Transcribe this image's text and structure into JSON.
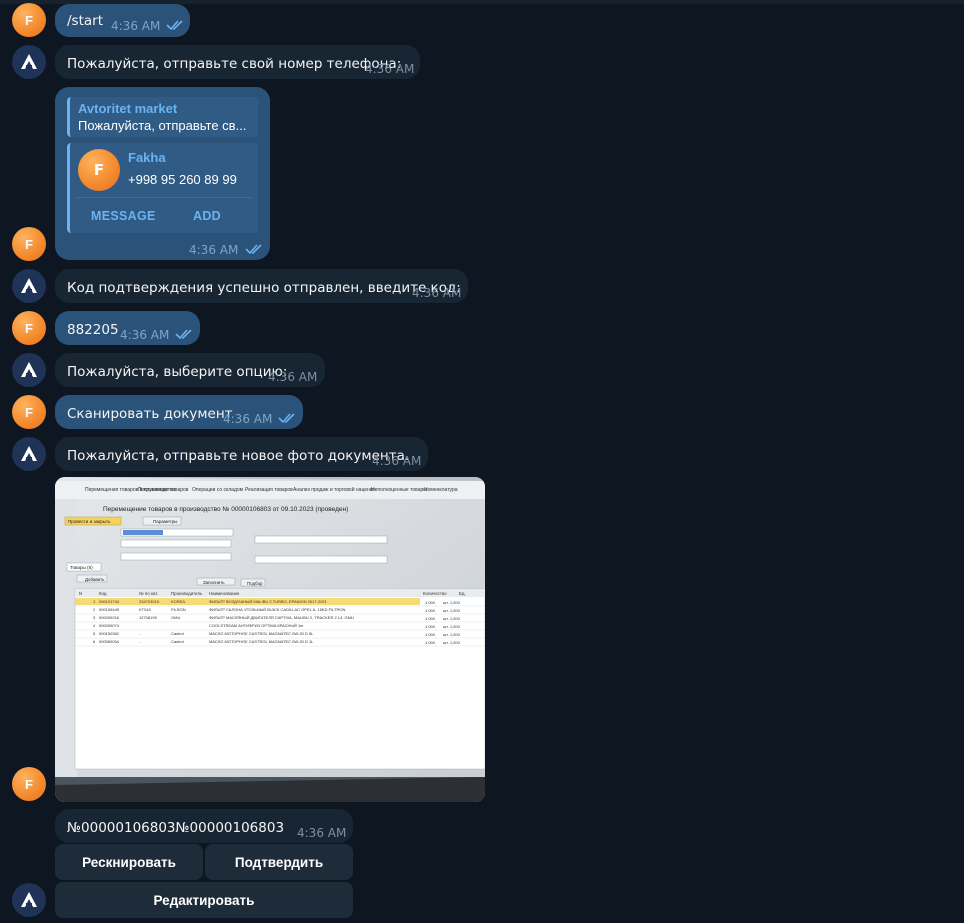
{
  "colors": {
    "background": "#0e1621",
    "outgoing": "#2b5278",
    "incoming": "#182533",
    "accent": "#6ab3f3"
  },
  "user_avatar_letter": "F",
  "messages": {
    "m1": {
      "text": "/start",
      "time": "4:36 AM"
    },
    "m2": {
      "text": "Пожалуйста, отправьте свой номер телефона:",
      "time": "4:36 AM"
    },
    "m3": {
      "reply_author": "Avtoritet market",
      "reply_text": "Пожалуйста, отправьте св...",
      "contact_letter": "F",
      "contact_name": "Fakha",
      "contact_phone": "+998 95 260 89 99",
      "message_label": "MESSAGE",
      "add_label": "ADD",
      "time": "4:36 AM"
    },
    "m4": {
      "text": "Код подтверждения успешно отправлен, введите код:",
      "time": "4:36 AM"
    },
    "m5": {
      "text": "882205",
      "time": "4:36 AM"
    },
    "m6": {
      "text": "Пожалуйста, выберите опцию:",
      "time": "4:36 AM"
    },
    "m7": {
      "text": "Сканировать документ",
      "time": "4:36 AM"
    },
    "m8": {
      "text": "Пожалуйста, отправьте новое фото документа.",
      "time": "4:36 AM"
    },
    "m9": {
      "text": "№00000106803№00000106803",
      "time": "4:36 AM"
    }
  },
  "photo": {
    "doc_title": "Перемещение товаров в производство № 00000106803 от 09.10.2023 (проведен)",
    "menu": [
      "Перемещения товаров в производство",
      "Поступление товаров",
      "Операции со складом",
      "Реализация товаров",
      "Анализ продаж и торговой наценки",
      "Неполноценные товары",
      "Номенклатура"
    ],
    "save_label": "Провести и закрыть",
    "params_label": "Параметры",
    "tab_label": "Товары (6)",
    "add_label": "Добавить",
    "fill_label": "Заполнить",
    "select_label": "Подбор",
    "cols": [
      "N",
      "Код",
      "№ по кат.",
      "Производитель",
      "Наименование",
      "Количество",
      "Ед."
    ],
    "rows": [
      [
        "1",
        "000101744",
        "234703015",
        "KOREA",
        "ФИЛЬТР ВОЗДУШНЫЙ MALIBU 2 TURBO, EPANION 2017-2021",
        "1,000",
        "шт. 1,000"
      ],
      [
        "2",
        "000106449",
        "KT043",
        "FILRON",
        "ФИЛЬТР САЛОНА УГОЛЬНЫЙ BUICK CADILLAC OPEL A, 15KD FILTRON",
        "1,000",
        "шт. 1,000"
      ],
      [
        "3",
        "000099216",
        "12708199",
        "GMU",
        "ФИЛЬТР МАСЛЯНЫЙ ДВИГАТЕЛЯ CAPTIVA, MALIBU 2, TRACKER 2 L4, GMU",
        "1,000",
        "шт. 1,000"
      ],
      [
        "4",
        "000099074",
        "",
        "",
        "COOLSTREAM АНТИФРИЗ OPTIMA КРАСНЫЙ 1кг",
        "1,000",
        "шт. 1,000"
      ],
      [
        "5",
        "000150362",
        "-",
        "Castrol",
        "МАСЛО МОТОРНОЕ CASTROL MAGNATEC 0W-30 D 5L",
        "1,000",
        "шт. 1,000"
      ],
      [
        "6",
        "000069004",
        "-",
        "Castrol",
        "МАСЛО МОТОРНОЕ CASTROL MAGNATEC 0W-30 D 1L",
        "1,000",
        "шт. 1,000"
      ]
    ]
  },
  "keyboard": {
    "rescan_label": "Рескнировать",
    "confirm_label": "Подтвердить",
    "edit_label": "Редактировать"
  }
}
